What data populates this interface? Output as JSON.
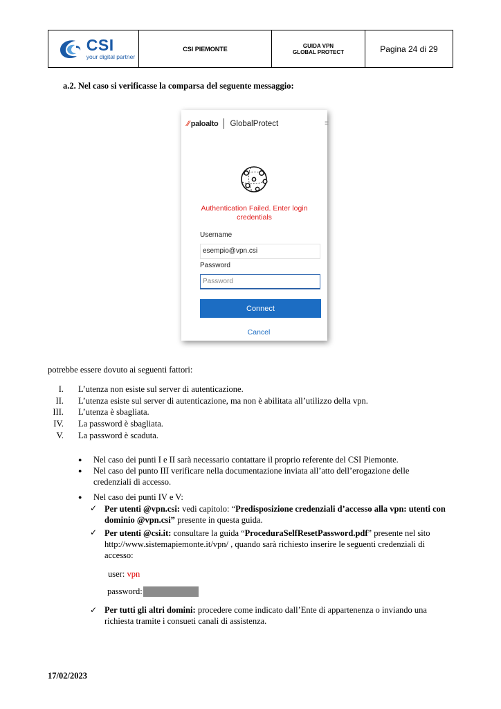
{
  "header": {
    "logo_text": "CSI",
    "logo_tagline": "your digital partner",
    "org": "CSI PIEMONTE",
    "guide_line1": "GUIDA VPN",
    "guide_line2": "GLOBAL PROTECT",
    "page": "Pagina 24 di 29"
  },
  "section_heading": "a.2.  Nel caso si verificasse la comparsa del seguente messaggio:",
  "screenshot": {
    "brand": "paloalto",
    "product": "GlobalProtect",
    "error_line1": "Authentication Failed. Enter login",
    "error_line2": "credentials",
    "username_label": "Username",
    "username_value": "esempio@vpn.csi",
    "password_label": "Password",
    "password_placeholder": "Password",
    "connect_label": "Connect",
    "cancel_label": "Cancel"
  },
  "intro": "potrebbe essere dovuto ai seguenti fattori:",
  "reasons": [
    {
      "num": "I.",
      "text": "L’utenza non esiste sul server di autenticazione."
    },
    {
      "num": "II.",
      "text": "L’utenza esiste sul server di autenticazione, ma non è abilitata all’utilizzo della vpn."
    },
    {
      "num": "III.",
      "text": "L’utenza è sbagliata."
    },
    {
      "num": "IV.",
      "text": "La password è sbagliata."
    },
    {
      "num": "V.",
      "text": "La password è scaduta."
    }
  ],
  "bullets": [
    {
      "text": "Nel caso dei punti I e II sarà necessario contattare il proprio referente del CSI Piemonte."
    },
    {
      "text": "Nel caso del punto III verificare nella documentazione inviata all’atto dell’erogazione delle credenziali di accesso."
    },
    {
      "text": "Nel caso dei punti IV e V:"
    }
  ],
  "checks": {
    "c1_bold": "Per utenti @vpn.csi:",
    "c1_text": " vedi capitolo: “",
    "c1_bold2": "Predisposizione credenziali d’accesso alla vpn: utenti con dominio @vpn.csi”",
    "c1_tail": " presente in questa guida.",
    "c2_bold": "Per utenti @csi.it:",
    "c2_text": " consultare la guida “",
    "c2_bold2": "ProceduraSelfResetPassword.pdf",
    "c2_tail": "” presente nel sito http://www.sistemapiemonte.it/vpn/ , quando sarà richiesto inserire le seguenti credenziali di accesso:",
    "user_label": "user: ",
    "user_value": "vpn",
    "password_label": "password:",
    "c3_bold": "Per tutti gli altri domini:",
    "c3_text": " procedere come indicato dall’Ente di appartenenza o inviando una richiesta tramite i consueti canali di assistenza."
  },
  "footer_date": "17/02/2023",
  "colors": {
    "brand_blue": "#1a5aa6",
    "error_red": "#e02020",
    "connect_blue": "#1c6dc3",
    "vpn_red": "#e10000"
  }
}
